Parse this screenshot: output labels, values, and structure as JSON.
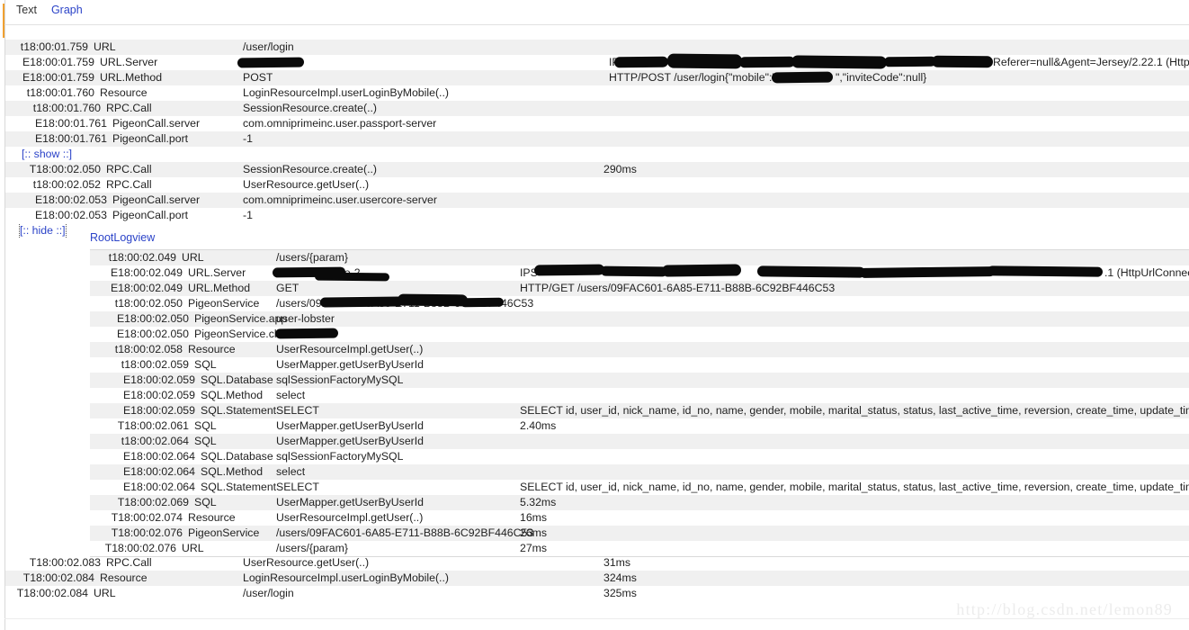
{
  "tabs": [
    {
      "label": "Text",
      "active": true
    },
    {
      "label": "Graph",
      "active": false
    }
  ],
  "toggles": {
    "show_label": "[:: show ::]",
    "hide_label": "[:: hide ::]"
  },
  "nested_title": "RootLogview",
  "watermark": "http://blog.csdn.net/lemon89",
  "colors": {
    "link": "#2b43c8",
    "row_stripe": "#f0f0f0",
    "accent": "#f0a030",
    "text": "#222222",
    "watermark": "#ececec"
  },
  "outer_rows": [
    {
      "time": "t18:00:01.759",
      "indent": 0,
      "type": "URL",
      "value": "/user/login",
      "dur": "",
      "extra": ""
    },
    {
      "time": "E18:00:01.759",
      "indent": 1,
      "type": "URL.Server",
      "value": "",
      "dur": "",
      "extra": "IPS="
    },
    {
      "time": "E18:00:01.759",
      "indent": 1,
      "type": "URL.Method",
      "value": "POST",
      "dur": "",
      "extra": "HTTP/POST /user/login{\"mobile\":\"",
      "extra2": "\",\"inviteCode\":null}"
    },
    {
      "time": "t18:00:01.760",
      "indent": 1,
      "type": "Resource",
      "value": "LoginResourceImpl.userLoginByMobile(..)",
      "dur": "",
      "extra": ""
    },
    {
      "time": "t18:00:01.760",
      "indent": 2,
      "type": "RPC.Call",
      "value": "SessionResource.create(..)",
      "dur": "",
      "extra": ""
    },
    {
      "time": "E18:00:01.761",
      "indent": 3,
      "type": "PigeonCall.server",
      "value": "com.omniprimeinc.user.passport-server",
      "dur": "",
      "extra": ""
    },
    {
      "time": "E18:00:01.761",
      "indent": 3,
      "type": "PigeonCall.port",
      "value": "-1",
      "dur": "",
      "extra": ""
    },
    {
      "time": "",
      "indent": 0,
      "type": "",
      "value": "",
      "dur": "",
      "extra": "",
      "toggle": "show"
    },
    {
      "time": "T18:00:02.050",
      "indent": 2,
      "type": "RPC.Call",
      "value": "SessionResource.create(..)",
      "dur": "290ms",
      "extra": ""
    },
    {
      "time": "t18:00:02.052",
      "indent": 2,
      "type": "RPC.Call",
      "value": "UserResource.getUser(..)",
      "dur": "",
      "extra": ""
    },
    {
      "time": "E18:00:02.053",
      "indent": 3,
      "type": "PigeonCall.server",
      "value": "com.omniprimeinc.user.usercore-server",
      "dur": "",
      "extra": ""
    },
    {
      "time": "E18:00:02.053",
      "indent": 3,
      "type": "PigeonCall.port",
      "value": "-1",
      "dur": "",
      "extra": ""
    },
    {
      "time": "",
      "indent": 0,
      "type": "",
      "value": "",
      "dur": "",
      "extra": "",
      "toggle": "hide"
    }
  ],
  "nested_rows": [
    {
      "time": "t18:00:02.049",
      "indent": 0,
      "type": "URL",
      "value": "/users/{param}",
      "dur": "",
      "extra": ""
    },
    {
      "time": "E18:00:02.049",
      "indent": 1,
      "type": "URL.Server",
      "value": "-base-usercore-2",
      "dur": "",
      "extra": "IPS="
    },
    {
      "time": "E18:00:02.049",
      "indent": 1,
      "type": "URL.Method",
      "value": "GET",
      "dur": "",
      "extra": "HTTP/GET /users/09FAC601-6A85-E711-B88B-6C92BF446C53"
    },
    {
      "time": "t18:00:02.050",
      "indent": 1,
      "type": "PigeonService",
      "value": "/users/09FAC601-6A85-E711-B88B-6C92BF446C53",
      "dur": "",
      "extra": ""
    },
    {
      "time": "E18:00:02.050",
      "indent": 2,
      "type": "PigeonService.app",
      "value": "user-lobster",
      "dur": "",
      "extra": ""
    },
    {
      "time": "E18:00:02.050",
      "indent": 2,
      "type": "PigeonService.client",
      "value": "",
      "dur": "",
      "extra": ""
    },
    {
      "time": "t18:00:02.058",
      "indent": 1,
      "type": "Resource",
      "value": "UserResourceImpl.getUser(..)",
      "dur": "",
      "extra": ""
    },
    {
      "time": "t18:00:02.059",
      "indent": 2,
      "type": "SQL",
      "value": "UserMapper.getUserByUserId",
      "dur": "",
      "extra": ""
    },
    {
      "time": "E18:00:02.059",
      "indent": 3,
      "type": "SQL.Database",
      "value": "sqlSessionFactoryMySQL",
      "dur": "",
      "extra": ""
    },
    {
      "time": "E18:00:02.059",
      "indent": 3,
      "type": "SQL.Method",
      "value": "select",
      "dur": "",
      "extra": ""
    },
    {
      "time": "E18:00:02.059",
      "indent": 3,
      "type": "SQL.Statement",
      "value": "SELECT",
      "dur": "",
      "extra": "SELECT id, user_id, nick_name, id_no, name, gender, mobile, marital_status, status, last_active_time, reversion, create_time, update_time,"
    },
    {
      "time": "T18:00:02.061",
      "indent": 2,
      "type": "SQL",
      "value": "UserMapper.getUserByUserId",
      "dur": "",
      "extra": "2.40ms"
    },
    {
      "time": "t18:00:02.064",
      "indent": 2,
      "type": "SQL",
      "value": "UserMapper.getUserByUserId",
      "dur": "",
      "extra": ""
    },
    {
      "time": "E18:00:02.064",
      "indent": 3,
      "type": "SQL.Database",
      "value": "sqlSessionFactoryMySQL",
      "dur": "",
      "extra": ""
    },
    {
      "time": "E18:00:02.064",
      "indent": 3,
      "type": "SQL.Method",
      "value": "select",
      "dur": "",
      "extra": ""
    },
    {
      "time": "E18:00:02.064",
      "indent": 3,
      "type": "SQL.Statement",
      "value": "SELECT",
      "dur": "",
      "extra": "SELECT id, user_id, nick_name, id_no, name, gender, mobile, marital_status, status, last_active_time, reversion, create_time, update_time,"
    },
    {
      "time": "T18:00:02.069",
      "indent": 2,
      "type": "SQL",
      "value": "UserMapper.getUserByUserId",
      "dur": "",
      "extra": "5.32ms"
    },
    {
      "time": "T18:00:02.074",
      "indent": 1,
      "type": "Resource",
      "value": "UserResourceImpl.getUser(..)",
      "dur": "",
      "extra": "16ms"
    },
    {
      "time": "T18:00:02.076",
      "indent": 1,
      "type": "PigeonService",
      "value": "/users/09FAC601-6A85-E711-B88B-6C92BF446C53",
      "dur": "",
      "extra": "26ms"
    },
    {
      "time": "T18:00:02.076",
      "indent": 0,
      "type": "URL",
      "value": "/users/{param}",
      "dur": "",
      "extra": "27ms"
    }
  ],
  "tail_rows": [
    {
      "time": "T18:00:02.083",
      "indent": 2,
      "type": "RPC.Call",
      "value": "UserResource.getUser(..)",
      "dur": "31ms",
      "extra": ""
    },
    {
      "time": "T18:00:02.084",
      "indent": 1,
      "type": "Resource",
      "value": "LoginResourceImpl.userLoginByMobile(..)",
      "dur": "324ms",
      "extra": ""
    },
    {
      "time": "T18:00:02.084",
      "indent": 0,
      "type": "URL",
      "value": "/user/login",
      "dur": "325ms",
      "extra": ""
    }
  ],
  "redacted_segments": {
    "outer_url_server_value": "redacted-ip",
    "outer_url_server_extra": "redacted-ip-and-agent",
    "outer_url_method_mobile": "redacted-mobile-number",
    "nested_url_server_value": "redacted-host-prefix",
    "nested_url_server_extra": "redacted-ip-and-server",
    "nested_pigeon_value": "redacted-uuid-middle",
    "nested_pigeon_client": "redacted-client-ip"
  },
  "agent_tail": {
    "outer": "Referer=null&Agent=Jersey/2.22.1 (Http",
    "nested_prefix": ".server-1c",
    "nested_suffix": ".1 (HttpUrlConnec"
  }
}
